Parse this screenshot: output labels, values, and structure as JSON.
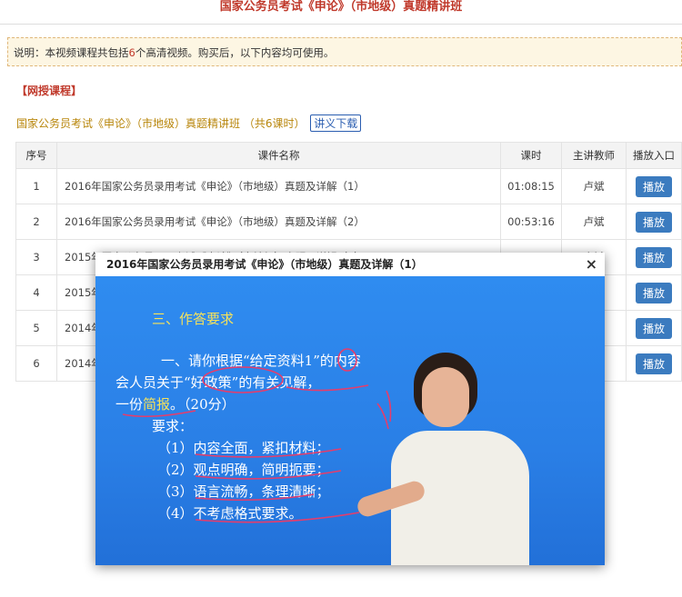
{
  "page": {
    "title": "国家公务员考试《申论》（市地级）真题精讲班"
  },
  "notice": {
    "prefix": "说明：本视频课程共包括",
    "count": "6",
    "suffix": "个高清视频。购买后，以下内容均可使用。"
  },
  "section": {
    "tag": "【网授课程】"
  },
  "course": {
    "name": "国家公务员考试《申论》（市地级）真题精讲班 （共6课时）",
    "download_label": "讲义下载"
  },
  "table": {
    "headers": [
      "序号",
      "课件名称",
      "课时",
      "主讲教师",
      "播放入口"
    ],
    "play_label": "播放",
    "rows": [
      {
        "no": "1",
        "name": "2016年国家公务员录用考试《申论》（市地级）真题及详解（1）",
        "duration": "01:08:15",
        "teacher": "卢斌"
      },
      {
        "no": "2",
        "name": "2016年国家公务员录用考试《申论》（市地级）真题及详解（2）",
        "duration": "00:53:16",
        "teacher": "卢斌"
      },
      {
        "no": "3",
        "name": "2015年国家公务员录用考试《申论》（市地级）真题及详解（1）",
        "duration": "01:09:43",
        "teacher": "卢斌"
      },
      {
        "no": "4",
        "name": "2015年",
        "duration": "",
        "teacher": ""
      },
      {
        "no": "5",
        "name": "2014年",
        "duration": "",
        "teacher": ""
      },
      {
        "no": "6",
        "name": "2014年",
        "duration": "",
        "teacher": ""
      }
    ]
  },
  "player": {
    "title": "2016年国家公务员录用考试《申论》（市地级）真题及详解（1）",
    "close": "×",
    "slide": {
      "heading": "三、作答要求",
      "line1": "一、请你根据“给定资料1”的内容",
      "line2": "会人员关于“好政策”的有关见解，",
      "line3a": "一份",
      "line3b": "简报",
      "line3c": "。（20分）",
      "req": "要求：",
      "items": [
        "（1）内容全面，紧扣材料；",
        "（2）观点明确，简明扼要；",
        "（3）语言流畅，条理清晰；",
        "（4）不考虑格式要求。"
      ]
    }
  },
  "colors": {
    "accent_red": "#c0392b",
    "play_blue": "#3b7bbf",
    "video_blue": "#2a7fe6"
  }
}
